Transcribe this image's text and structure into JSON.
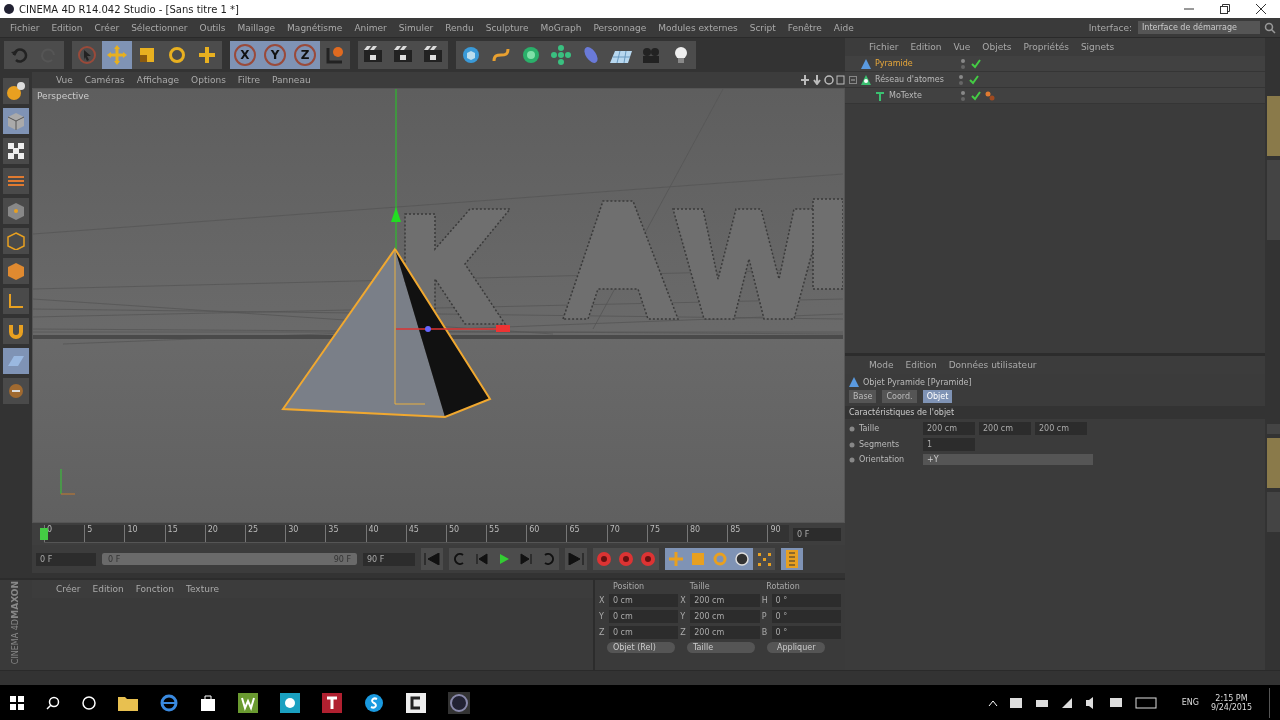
{
  "window": {
    "title": "CINEMA 4D R14.042 Studio - [Sans titre 1 *]"
  },
  "menu": [
    "Fichier",
    "Edition",
    "Créer",
    "Sélectionner",
    "Outils",
    "Maillage",
    "Magnétisme",
    "Animer",
    "Simuler",
    "Rendu",
    "Sculpture",
    "MoGraph",
    "Personnage",
    "Modules externes",
    "Script",
    "Fenêtre",
    "Aide"
  ],
  "interface": {
    "label": "Interface:",
    "value": "Interface de démarrage"
  },
  "toolbar": [
    {
      "kind": "undo",
      "selected": false
    },
    {
      "kind": "redo",
      "selected": false
    },
    {
      "kind": "select",
      "selected": false
    },
    {
      "kind": "move",
      "selected": true
    },
    {
      "kind": "scale",
      "selected": false
    },
    {
      "kind": "rotate",
      "selected": false
    },
    {
      "kind": "add",
      "selected": false
    },
    {
      "kind": "axis",
      "label": "X",
      "selected": true
    },
    {
      "kind": "axis",
      "label": "Y",
      "selected": true
    },
    {
      "kind": "axis",
      "label": "Z",
      "selected": true
    },
    {
      "kind": "coords",
      "selected": false
    },
    {
      "kind": "render",
      "selected": false
    },
    {
      "kind": "render",
      "selected": false
    },
    {
      "kind": "render",
      "selected": false
    },
    {
      "kind": "cube",
      "selected": false
    },
    {
      "kind": "spline",
      "selected": false
    },
    {
      "kind": "nurbs",
      "selected": false
    },
    {
      "kind": "array",
      "selected": false
    },
    {
      "kind": "deformer",
      "selected": false
    },
    {
      "kind": "floor",
      "selected": false
    },
    {
      "kind": "camera",
      "selected": false
    },
    {
      "kind": "light",
      "selected": false
    }
  ],
  "viewport": {
    "menu": [
      "Vue",
      "Caméras",
      "Affichage",
      "Options",
      "Filtre",
      "Panneau"
    ],
    "label": "Perspective"
  },
  "object_manager": {
    "menu": [
      "Fichier",
      "Edition",
      "Vue",
      "Objets",
      "Propriétés",
      "Signets"
    ],
    "objects": [
      {
        "name": "Pyramide",
        "kind": "pyramid",
        "selected": true
      },
      {
        "name": "Réseau d'atomes",
        "kind": "atom",
        "selected": false,
        "expanded": true,
        "children": [
          {
            "name": "MoTexte",
            "kind": "text",
            "selected": false,
            "tag": true
          }
        ]
      }
    ]
  },
  "attributes": {
    "menu": [
      "Mode",
      "Edition",
      "Données utilisateur"
    ],
    "title": "Objet Pyramide [Pyramide]",
    "tabs": [
      {
        "label": "Base",
        "selected": false
      },
      {
        "label": "Coord.",
        "selected": false
      },
      {
        "label": "Objet",
        "selected": true
      }
    ],
    "section": "Caractéristiques de l'objet",
    "fields": [
      {
        "label": "Taille",
        "kind": "numbers",
        "values": [
          "200 cm",
          "200 cm",
          "200 cm"
        ]
      },
      {
        "label": "Segments",
        "kind": "numbers",
        "values": [
          "1"
        ]
      },
      {
        "label": "Orientation",
        "kind": "dropdown",
        "value": "+Y"
      }
    ]
  },
  "timeline": {
    "ticks": [
      "0",
      "5",
      "10",
      "15",
      "20",
      "25",
      "30",
      "35",
      "40",
      "45",
      "50",
      "55",
      "60",
      "65",
      "70",
      "75",
      "80",
      "85",
      "90"
    ],
    "current": "0 F",
    "start": "0 F",
    "level": 1,
    "range_start": "0 F",
    "range_end": "90 F",
    "end": "90 F"
  },
  "material_manager": {
    "menu": [
      "Créer",
      "Edition",
      "Fonction",
      "Texture"
    ]
  },
  "logo": {
    "brand": "MAXON",
    "product": "CINEMA 4D"
  },
  "coordinates": {
    "headers": [
      "Position",
      "Taille",
      "Rotation"
    ],
    "rows": [
      {
        "p_axis": "X",
        "position": "0 cm",
        "s_axis": "X",
        "size": "200 cm",
        "r_axis": "H",
        "rotation": "0 °"
      },
      {
        "p_axis": "Y",
        "position": "0 cm",
        "s_axis": "Y",
        "size": "200 cm",
        "r_axis": "P",
        "rotation": "0 °"
      },
      {
        "p_axis": "Z",
        "position": "0 cm",
        "s_axis": "Z",
        "size": "200 cm",
        "r_axis": "B",
        "rotation": "0 °"
      }
    ],
    "mode": "Objet (Rel)",
    "size_mode": "Taille",
    "apply": "Appliquer"
  },
  "taskbar": {
    "language": "ENG",
    "time": "2:15 PM",
    "date": "9/24/2015"
  }
}
